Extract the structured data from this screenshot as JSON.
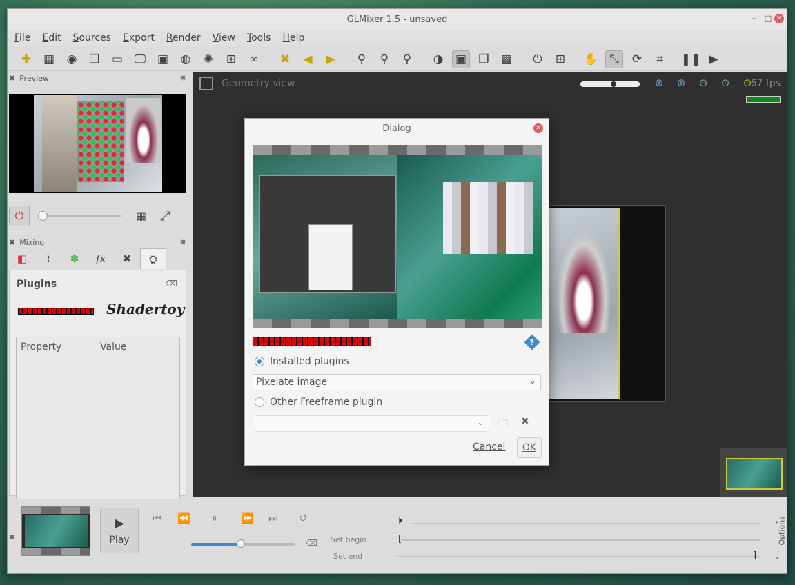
{
  "window": {
    "title": "GLMixer 1.5 - unsaved"
  },
  "menu": [
    "File",
    "Edit",
    "Sources",
    "Export",
    "Render",
    "View",
    "Tools",
    "Help"
  ],
  "panels": {
    "preview": "Preview",
    "mixing": "Mixing",
    "plugins": "Plugins",
    "property_header": "Property",
    "value_header": "Value",
    "shadertoy": "Shadertoy"
  },
  "view": {
    "title": "Geometry view",
    "fps": "67 fps"
  },
  "dialog": {
    "title": "Dialog",
    "installed_label": "Installed plugins",
    "selected_plugin": "Pixelate image",
    "other_label": "Other Freeframe plugin",
    "other_value": "",
    "cancel": "Cancel",
    "ok": "OK",
    "help": "?"
  },
  "timer": {
    "play_label": "Play",
    "set_begin": "Set begin",
    "set_end": "Set end",
    "options": "Options"
  },
  "colors": {
    "accent": "#3a8ad8",
    "close": "#e35d5d",
    "selection": "#a020a0",
    "fps_ok": "#0a8a1a"
  }
}
